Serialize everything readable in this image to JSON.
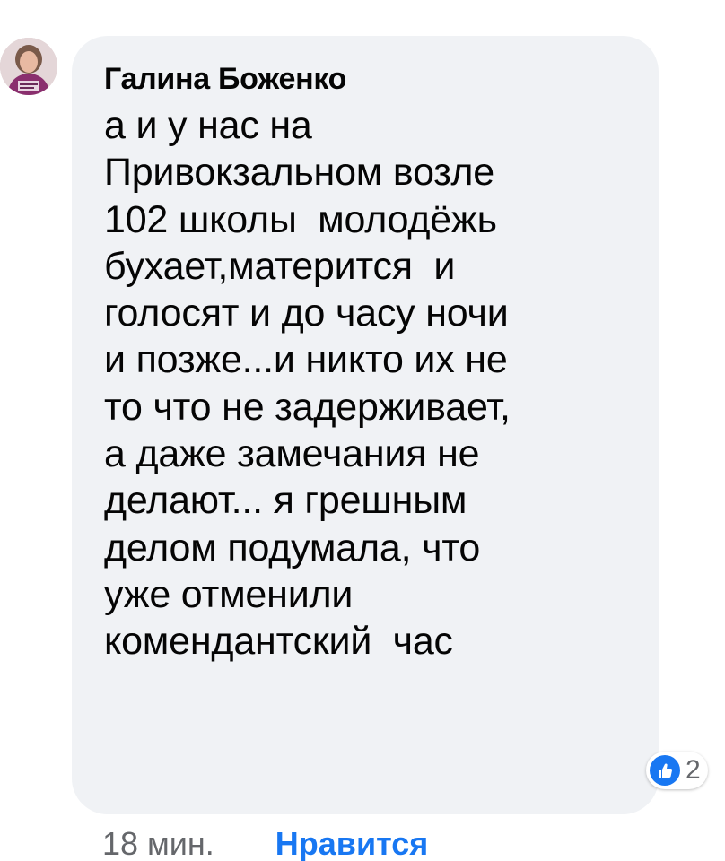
{
  "comment": {
    "author": "Галина Боженко",
    "text_lines": [
      "а и у нас на",
      "Привокзальном возле",
      "102 школы  молодёжь",
      "бухает,матерится  и",
      "голосят и до часу ночи",
      "и позже...и никто их не",
      "то что не задерживает,",
      "а даже замечания не",
      "делают... я грешным",
      "делом подумала, что",
      "уже отменили",
      "комендантский  час"
    ]
  },
  "reactions": {
    "icon": "thumbs-up-icon",
    "count": "2",
    "color": "#1877f2"
  },
  "footer": {
    "timestamp": "18 мин.",
    "like_label": "Нравится"
  },
  "colors": {
    "bubble": "#f0f2f5",
    "text": "#050505",
    "muted": "#65676b",
    "accent": "#1877f2"
  }
}
